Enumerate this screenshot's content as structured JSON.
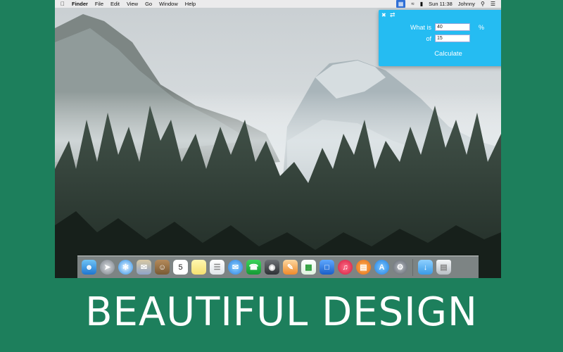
{
  "menubar": {
    "apple_icon": "apple-logo-icon",
    "app": "Finder",
    "menus": [
      "File",
      "Edit",
      "View",
      "Go",
      "Window",
      "Help"
    ],
    "clock": "Sun 11:38",
    "user": "Johnny"
  },
  "widget": {
    "question_label": "What is",
    "percent_value": "40",
    "percent_unit": "%",
    "of_label": "of",
    "of_value": "15",
    "calculate_label": "Calculate"
  },
  "dock": {
    "apps": [
      "Finder",
      "Launchpad",
      "Safari",
      "Mail",
      "Contacts",
      "Calendar",
      "Notes",
      "Reminders",
      "Messages",
      "FaceTime",
      "Photo Booth",
      "Pages",
      "Numbers",
      "Keynote",
      "iTunes",
      "iBooks",
      "App Store",
      "System Preferences",
      "Downloads",
      "Trash"
    ],
    "calendar_day": "5"
  },
  "caption": "BEAUTIFUL DESIGN"
}
